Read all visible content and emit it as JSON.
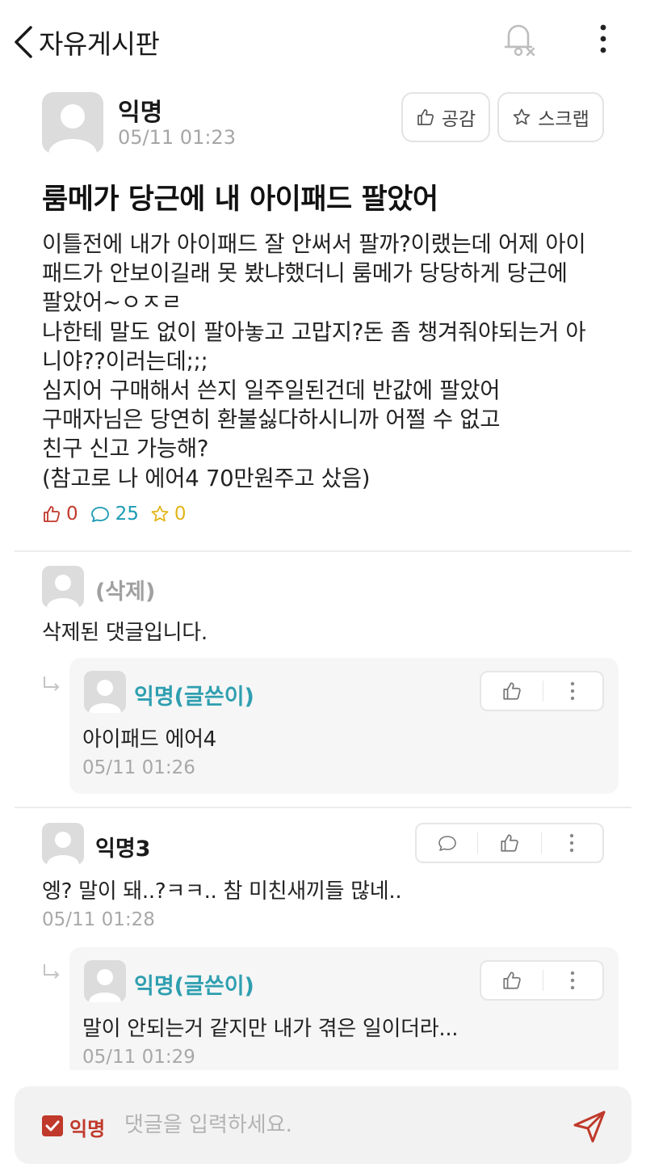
{
  "header": {
    "title": "자유게시판"
  },
  "post": {
    "author": "익명",
    "time": "05/11 01:23",
    "like_button_label": "공감",
    "scrap_button_label": "스크랩",
    "title": "룸메가 당근에 내 아이패드 팔았어",
    "body_lines": [
      "이틀전에 내가 아이패드 잘 안써서 팔까?이랬는데 어제 아이",
      "패드가 안보이길래 못 봤냐했더니 룸메가 당당하게 당근에",
      "팔았어~ㅇㅈㄹ",
      "나한테 말도 없이 팔아놓고 고맙지?돈 좀 챙겨줘야되는거 아",
      "니야??이러는데;;;",
      "심지어 구매해서 쓴지 일주일된건데 반값에 팔았어",
      "구매자님은 당연히 환불싫다하시니까 어쩔 수 없고",
      "친구 신고 가능해?",
      "(참고로 나 에어4 70만원주고 샀음)"
    ],
    "stats": {
      "likes": "0",
      "comments": "25",
      "scraps": "0"
    }
  },
  "comments": [
    {
      "author": "(삭제)",
      "text": "삭제된 댓글입니다.",
      "reply": {
        "author": "익명(글쓴이)",
        "text": "아이패드 에어4",
        "time": "05/11 01:26"
      }
    },
    {
      "author": "익명3",
      "text": "엥? 말이 돼..?ㅋㅋ.. 참 미친새끼들 많네..",
      "time": "05/11 01:28",
      "reply": {
        "author": "익명(글쓴이)",
        "text": "말이 안되는거 같지만 내가 겪은 일이더라...",
        "time": "05/11 01:29"
      }
    }
  ],
  "input_bar": {
    "anon_label": "익명",
    "placeholder": "댓글을 입력하세요."
  },
  "colors": {
    "accent_red": "#c0392b",
    "teal": "#2f9fb0",
    "comment_blue": "#1a9bb3",
    "scrap_yellow": "#e2b51a"
  },
  "icons": [
    "back-chevron-icon",
    "bell-off-icon",
    "more-vertical-icon",
    "thumbs-up-icon",
    "star-icon",
    "speech-bubble-icon",
    "reply-arrow-icon",
    "checkbox-icon",
    "send-icon"
  ]
}
